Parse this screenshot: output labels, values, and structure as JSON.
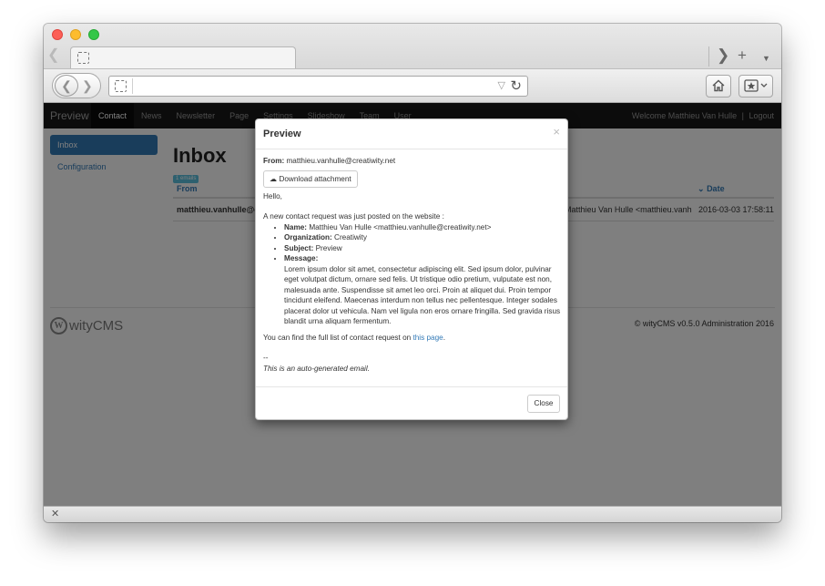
{
  "browser": {
    "tab_back_icon": "chevron-left",
    "tab_forward_icon": "chevron-right",
    "new_tab_icon": "plus",
    "tab_menu_icon": "chevron-down",
    "url": "",
    "home_icon": "home",
    "bookmarks_icon": "star-box",
    "status_close_icon": "x"
  },
  "nav": {
    "brand": "Preview",
    "items": [
      "Contact",
      "News",
      "Newsletter",
      "Page",
      "Settings",
      "Slideshow",
      "Team",
      "User"
    ],
    "active": "Contact",
    "welcome": "Welcome Matthieu Van Hulle",
    "separator": "|",
    "logout": "Logout"
  },
  "sidebar": {
    "items": [
      {
        "label": "Inbox",
        "active": true
      },
      {
        "label": "Configuration",
        "active": false
      }
    ]
  },
  "inbox": {
    "title": "Inbox",
    "badge": "1 emails",
    "columns": {
      "from": "From",
      "date": "Date"
    },
    "sort_icon": "chevron-down",
    "row": {
      "from": "matthieu.vanhulle@cre",
      "to": "Matthieu Van Hulle <matthieu.vanhull...",
      "date": "2016-03-03 17:58:11"
    }
  },
  "footer": {
    "logo_letter": "W",
    "logo_text": "wityCMS",
    "copyright": "© wityCMS v0.5.0 Administration 2016"
  },
  "modal": {
    "title": "Preview",
    "close_x": "×",
    "from_label": "From:",
    "from_value": "matthieu.vanhulle@creatiwity.net",
    "download_label": "Download attachment",
    "download_icon": "cloud-download",
    "greeting": "Hello,",
    "intro": "A new contact request was just posted on the website :",
    "fields": [
      {
        "label": "Name:",
        "value": "Matthieu Van Hulle <matthieu.vanhulle@creatiwity.net>"
      },
      {
        "label": "Organization:",
        "value": "Creatiwity"
      },
      {
        "label": "Subject:",
        "value": "Preview"
      },
      {
        "label": "Message:",
        "value": ""
      }
    ],
    "message": "Lorem ipsum dolor sit amet, consectetur adipiscing elit. Sed ipsum dolor, pulvinar eget volutpat dictum, ornare sed felis. Ut tristique odio pretium, vulputate est non, malesuada ante. Suspendisse sit amet leo orci. Proin at aliquet dui. Proin tempor tincidunt eleifend. Maecenas interdum non tellus nec pellentesque. Integer sodales placerat dolor ut vehicula. Nam vel ligula non eros ornare fringilla. Sed gravida risus blandit urna aliquam fermentum.",
    "full_list_text": "You can find the full list of contact request on",
    "full_list_link": "this page",
    "full_list_end": ".",
    "sig_dash": "--",
    "signature": "This is an auto-generated email.",
    "close_button": "Close"
  }
}
